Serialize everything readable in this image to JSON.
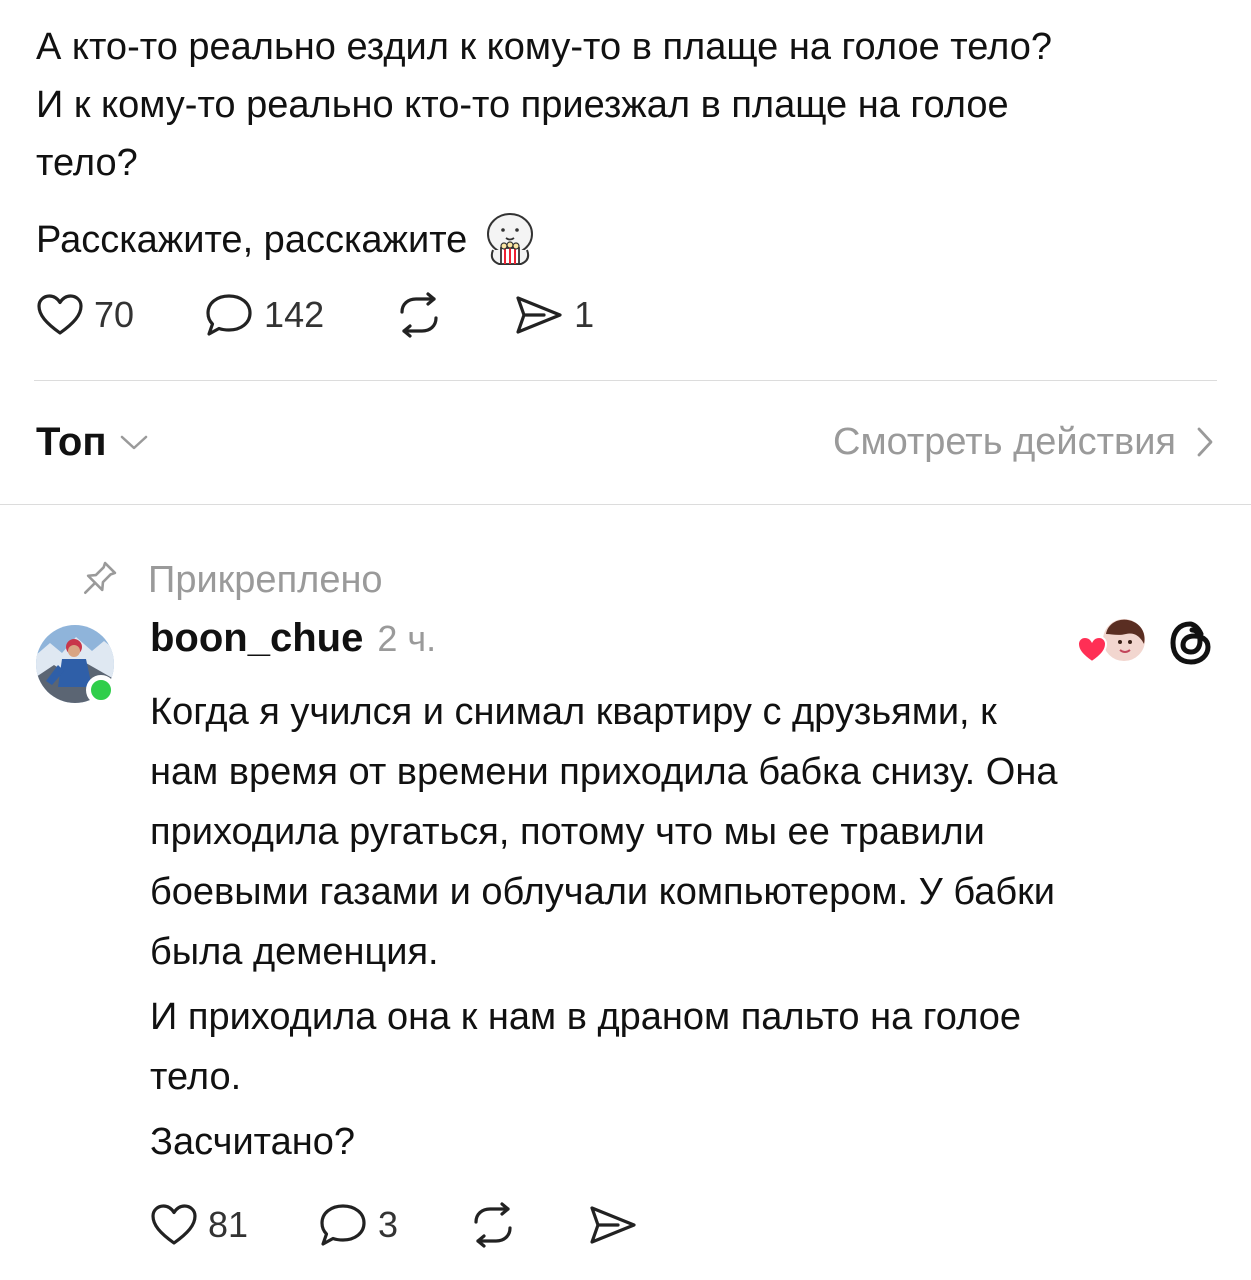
{
  "post": {
    "lines": [
      "А кто-то реально ездил к кому-то в плаще на голое тело?",
      "И к кому-то реально кто-то приезжал в плаще на голое",
      "тело?"
    ],
    "para2": "Расскажите, расскажите",
    "emoji": "popcorn-sticker",
    "likes": "70",
    "replies": "142",
    "shares": "1"
  },
  "sort": {
    "label": "Топ",
    "view_activity": "Смотреть действия"
  },
  "pinned_label": "Прикреплено",
  "comment": {
    "username": "boon_chue",
    "time": "2 ч.",
    "paragraphs": [
      [
        "Когда я учился и снимал квартиру с друзьями, к",
        "нам время от времени приходила бабка снизу. Она",
        "приходила ругаться, потому что мы ее травили",
        "боевыми газами и облучали компьютером. У бабки",
        "была деменция."
      ],
      [
        "И приходила она к нам в драном пальто на голое",
        "тело."
      ],
      [
        "Засчитано?"
      ]
    ],
    "likes": "81",
    "replies": "3"
  },
  "colors": {
    "text": "#111111",
    "muted": "#9a9a9a",
    "divider": "#dcdcdc",
    "online": "#2fce4a",
    "heart_red": "#ff2f55"
  }
}
